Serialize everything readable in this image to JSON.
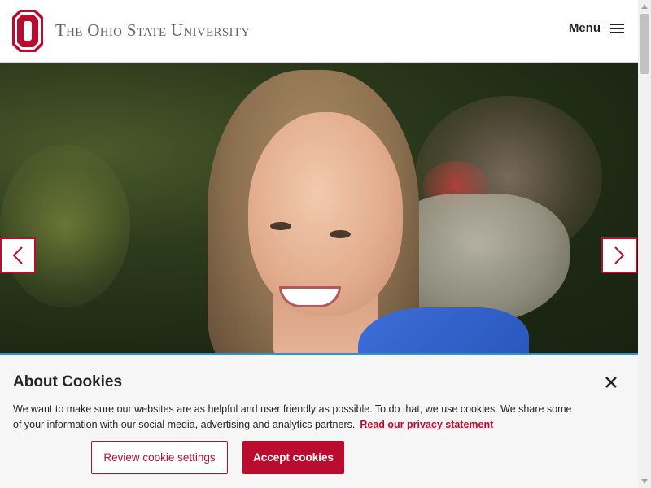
{
  "header": {
    "wordmark": "The Ohio State University",
    "logo_letter": "O",
    "menu_label": "Menu",
    "menu_icon": "hamburger-icon"
  },
  "hero": {
    "prev_icon": "chevron-left-icon",
    "next_icon": "chevron-right-icon"
  },
  "cookie": {
    "title": "About Cookies",
    "body": "We want to make sure our websites are as helpful and user friendly as possible. To do that, we use cookies. We share some of your information with our social media, advertising and analytics partners.",
    "link": "Read our privacy statement",
    "review_button": "Review cookie settings",
    "accept_button": "Accept cookies",
    "close_icon": "close-icon"
  },
  "colors": {
    "scarlet": "#ba0c2f",
    "gray_text": "#666666",
    "dark_text": "#212325",
    "accent_rule": "#3f8fb6"
  }
}
